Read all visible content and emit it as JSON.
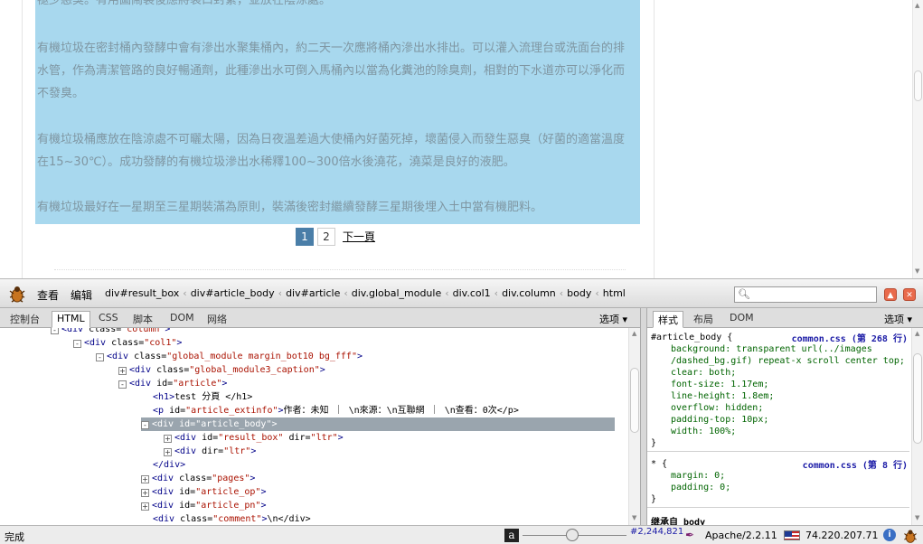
{
  "article": {
    "paragraphs": [
      "褪少惡臭。有用圖鬧裝後應將袋口封緊，並放在陰涼處。",
      "有機垃圾在密封桶內發酵中會有滲出水聚集桶內，約二天一次應將桶內滲出水排出。可以灌入流理台或洗面台的排水管，作為清潔管路的良好暢通劑，此種滲出水可倒入馬桶內以當為化糞池的除臭劑，相對的下水道亦可以淨化而不發臭。",
      "有機垃圾桶應放在陰涼處不可曬太陽，因為日夜溫差過大使桶內好菌死掉，壞菌侵入而發生惡臭（好菌的適當溫度在15~30℃）。成功發酵的有機垃圾滲出水稀釋100~300倍水後澆花，澆菜是良好的液肥。",
      "有機垃圾最好在一星期至三星期裝滿為原則，裝滿後密封繼續發酵三星期後埋入土中當有機肥料。"
    ],
    "pagination": {
      "pages": [
        "1",
        "2"
      ],
      "active": "1",
      "next_label": "下一頁"
    }
  },
  "firebug": {
    "menu": {
      "view": "查看",
      "edit": "编辑"
    },
    "breadcrumbs": [
      "div#result_box",
      "div#article_body",
      "div#article",
      "div.global_module",
      "div.col1",
      "div.column",
      "body",
      "html"
    ],
    "search": {
      "value": "",
      "placeholder": ""
    },
    "left_tabs": {
      "console": "控制台",
      "html": "HTML",
      "css": "CSS",
      "script": "脚本",
      "dom": "DOM",
      "net": "网络",
      "selected": "HTML",
      "options": "选项"
    },
    "right_tabs": {
      "style": "样式",
      "layout": "布局",
      "dom": "DOM",
      "selected": "样式",
      "options": "选项"
    },
    "html_tree": [
      {
        "indent": 0,
        "twisty": "-",
        "tag": "div",
        "attrs": [
          [
            "class",
            "column"
          ]
        ],
        "close": ">",
        "text": ""
      },
      {
        "indent": 1,
        "twisty": "-",
        "tag": "div",
        "attrs": [
          [
            "class",
            "col1"
          ]
        ],
        "close": ">",
        "text": ""
      },
      {
        "indent": 2,
        "twisty": "-",
        "tag": "div",
        "attrs": [
          [
            "class",
            "global_module margin_bot10 bg_fff"
          ]
        ],
        "close": ">",
        "text": ""
      },
      {
        "indent": 3,
        "twisty": "+",
        "tag": "div",
        "attrs": [
          [
            "class",
            "global_module3_caption"
          ]
        ],
        "close": ">",
        "text": ""
      },
      {
        "indent": 3,
        "twisty": "-",
        "tag": "div",
        "attrs": [
          [
            "id",
            "article"
          ]
        ],
        "close": ">",
        "text": ""
      },
      {
        "indent": 4,
        "twisty": "",
        "tag": "h1",
        "attrs": [],
        "close": ">",
        "text": "test 分頁 </h1>"
      },
      {
        "indent": 4,
        "twisty": "",
        "tag": "p",
        "attrs": [
          [
            "id",
            "article_extinfo"
          ]
        ],
        "close": ">",
        "text": "作者：未知 ｜ \\n來源：\\n互聯網 ｜ \\n查看：0次</p>"
      },
      {
        "indent": 4,
        "twisty": "-",
        "tag": "div",
        "attrs": [
          [
            "id",
            "article_body"
          ]
        ],
        "close": ">",
        "text": "",
        "selected": true
      },
      {
        "indent": 5,
        "twisty": "+",
        "tag": "div",
        "attrs": [
          [
            "id",
            "result_box"
          ],
          [
            "dir",
            "ltr"
          ]
        ],
        "close": ">",
        "text": ""
      },
      {
        "indent": 5,
        "twisty": "+",
        "tag": "div",
        "attrs": [
          [
            "dir",
            "ltr"
          ]
        ],
        "close": ">",
        "text": ""
      },
      {
        "indent": 4,
        "twisty": "",
        "tag": "/div",
        "attrs": [],
        "close": ">",
        "text": ""
      },
      {
        "indent": 4,
        "twisty": "+",
        "tag": "div",
        "attrs": [
          [
            "class",
            "pages"
          ]
        ],
        "close": ">",
        "text": ""
      },
      {
        "indent": 4,
        "twisty": "+",
        "tag": "div",
        "attrs": [
          [
            "id",
            "article_op"
          ]
        ],
        "close": ">",
        "text": ""
      },
      {
        "indent": 4,
        "twisty": "+",
        "tag": "div",
        "attrs": [
          [
            "id",
            "article_pn"
          ]
        ],
        "close": ">",
        "text": ""
      },
      {
        "indent": 4,
        "twisty": "",
        "tag": "div",
        "attrs": [
          [
            "class",
            "comment"
          ]
        ],
        "close": ">",
        "text": "\\n</div>"
      }
    ],
    "css_rules": [
      {
        "selector": "#article_body {",
        "source": "common.css (第 268 行)",
        "props": [
          "background: transparent url(../images",
          "/dashed_bg.gif) repeat-x scroll center top;",
          "clear: both;",
          "font-size: 1.17em;",
          "line-height: 1.8em;",
          "overflow: hidden;",
          "padding-top: 10px;",
          "width: 100%;"
        ],
        "end": "}"
      },
      {
        "selector": "* {",
        "source": "common.css (第 8 行)",
        "props": [
          "margin: 0;",
          "padding: 0;"
        ],
        "end": "}"
      }
    ],
    "css_more": "继承自 body"
  },
  "statusbar": {
    "text": "完成",
    "coords": "#2,244,821",
    "server": "Apache/2.2.11",
    "ip": "74.220.207.71"
  },
  "colors": {
    "highlight": "#a8d8ee",
    "selected_row": "#9aa5ae",
    "tag": "#000088",
    "attr_value": "#aa1100",
    "css_source": "#1a1aa6"
  }
}
